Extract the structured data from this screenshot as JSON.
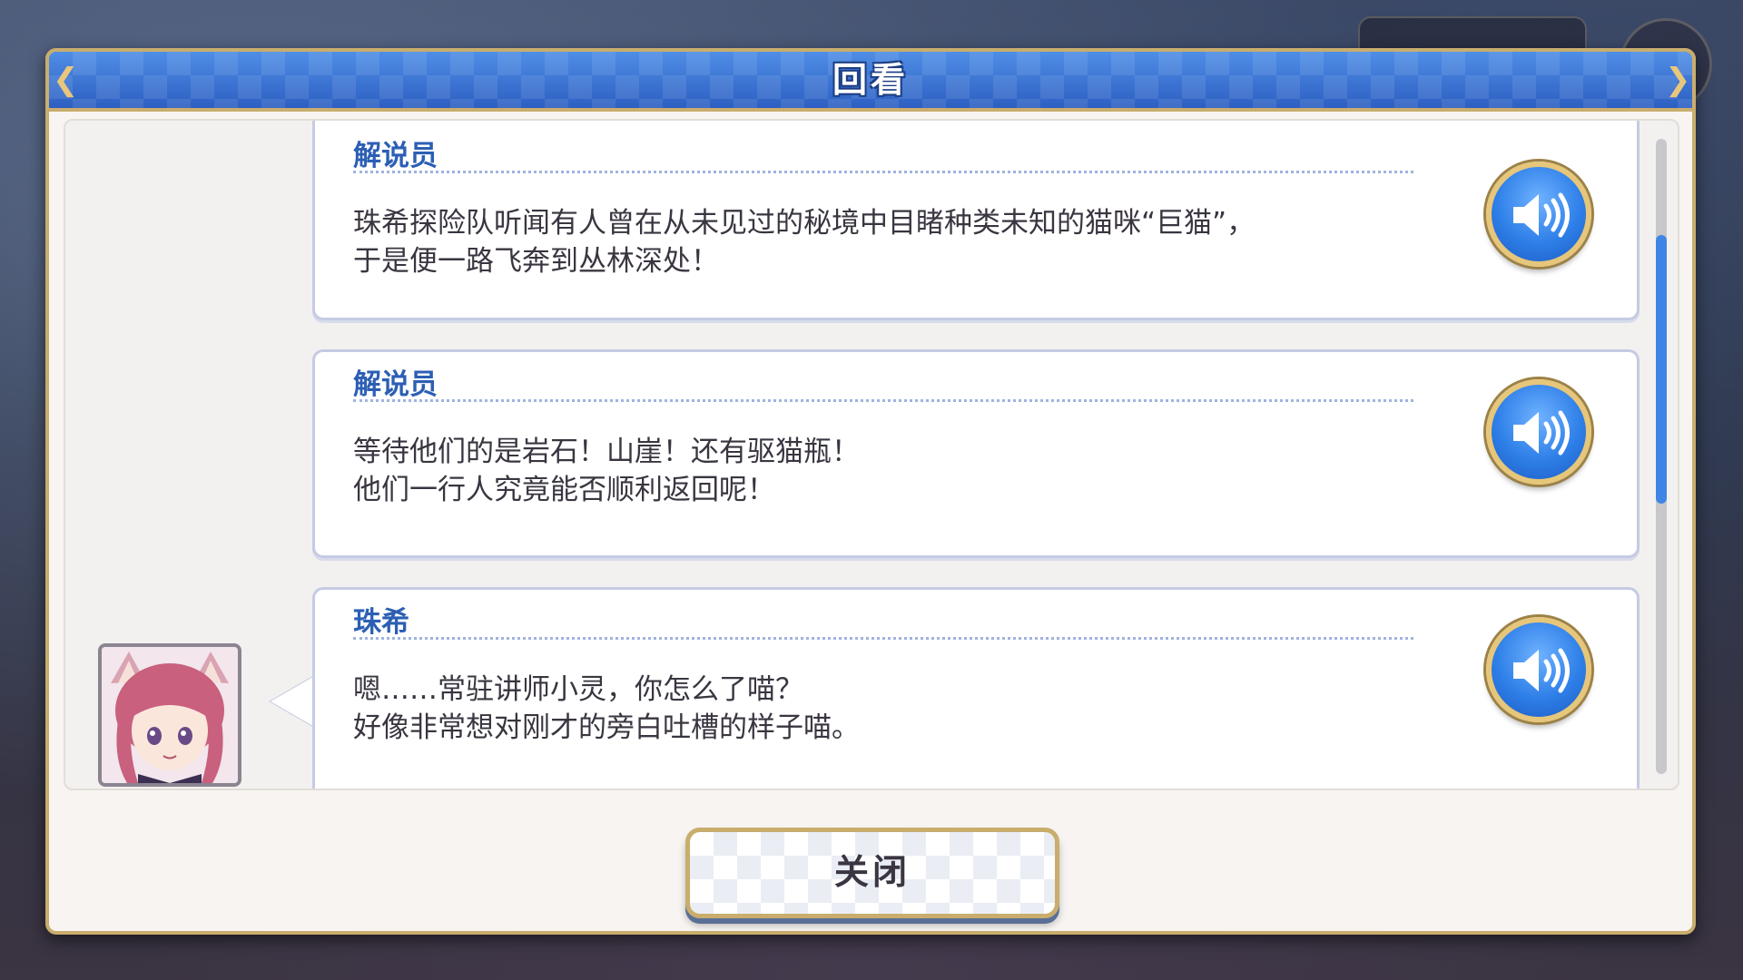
{
  "window": {
    "title": "回看"
  },
  "log": {
    "entries": [
      {
        "speaker": "解说员",
        "lines": [
          "珠希探险队听闻有人曾在从未见过的秘境中目睹种类未知的猫咪“巨猫”，",
          "于是便一路飞奔到丛林深处！"
        ],
        "has_portrait": false
      },
      {
        "speaker": "解说员",
        "lines": [
          "等待他们的是岩石！山崖！还有驱猫瓶！",
          "他们一行人究竟能否顺利返回呢！"
        ],
        "has_portrait": false
      },
      {
        "speaker": "珠希",
        "lines": [
          "嗯……常驻讲师小灵，你怎么了喵？",
          "好像非常想对刚才的旁白吐槽的样子喵。"
        ],
        "has_portrait": true
      }
    ]
  },
  "scroll": {
    "position_fraction": 0.17
  },
  "footer": {
    "close_label": "关闭"
  },
  "icons": {
    "voice": "speaker-volume-icon",
    "corner": "ornament-icon"
  },
  "colors": {
    "accent_blue": "#2d5fc2",
    "gold_border": "#c9ad6d",
    "speaker_name": "#2c5fb4"
  }
}
